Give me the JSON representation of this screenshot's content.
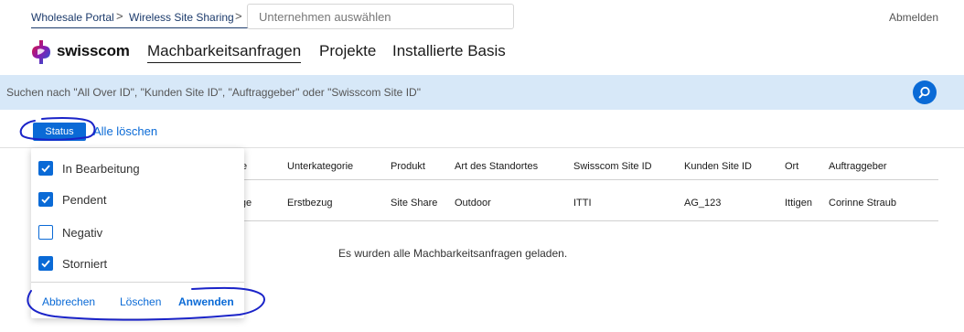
{
  "breadcrumb": {
    "items": [
      "Wholesale Portal",
      "Wireless Site Sharing"
    ],
    "separator": ">"
  },
  "company_select": {
    "placeholder": "Unternehmen auswählen"
  },
  "header": {
    "logout": "Abmelden"
  },
  "brand": {
    "name": "swisscom"
  },
  "nav": {
    "items": [
      {
        "label": "Machbarkeitsanfragen",
        "active": true
      },
      {
        "label": "Projekte",
        "active": false
      },
      {
        "label": "Installierte Basis",
        "active": false
      }
    ]
  },
  "search": {
    "placeholder": "Suchen nach \"All Over ID\", \"Kunden Site ID\", \"Auftraggeber\" oder \"Swisscom Site ID\"",
    "icon": "search-icon"
  },
  "filters": {
    "status_label": "Status",
    "clear_all": "Alle löschen"
  },
  "status_dropdown": {
    "options": [
      {
        "label": "In Bearbeitung",
        "checked": true
      },
      {
        "label": "Pendent",
        "checked": true
      },
      {
        "label": "Negativ",
        "checked": false
      },
      {
        "label": "Storniert",
        "checked": true
      }
    ],
    "cancel": "Abbrechen",
    "clear": "Löschen",
    "apply": "Anwenden"
  },
  "table": {
    "columns": [
      "e",
      "Unterkategorie",
      "Produkt",
      "Art des Standortes",
      "Swisscom Site ID",
      "Kunden Site ID",
      "Ort",
      "Auftraggeber"
    ],
    "rows": [
      [
        "frage",
        "Erstbezug",
        "Site Share",
        "Outdoor",
        "ITTI",
        "AG_123",
        "Ittigen",
        "Corinne Straub"
      ]
    ]
  },
  "status_message": "Es wurden alle Machbarkeitsanfragen geladen.",
  "colors": {
    "accent": "#0a6ad6",
    "search_bg": "#d7e8f8",
    "annotation": "#1a23c8"
  }
}
